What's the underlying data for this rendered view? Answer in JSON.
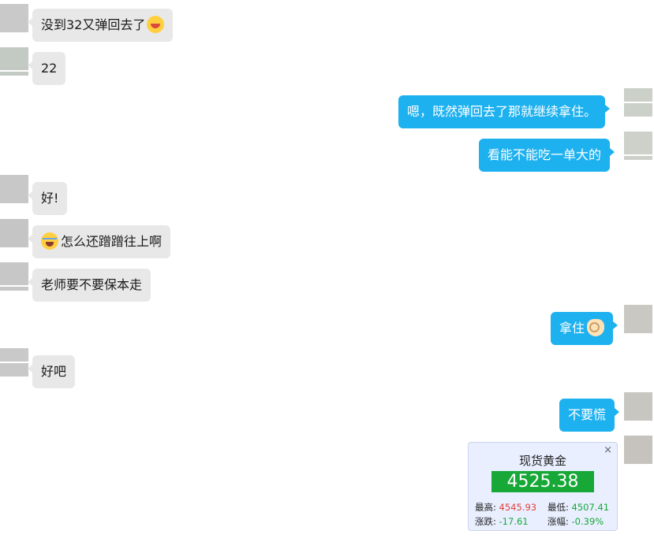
{
  "colors": {
    "incoming_bubble": "#e8e8e8",
    "outgoing_bubble": "#1eb1ef",
    "price_box": "#17a837",
    "up_red": "#e3413c",
    "down_green": "#17a837"
  },
  "messages": [
    {
      "side": "left",
      "text": "没到32又弹回去了",
      "emoji_after": "laughing-emoji"
    },
    {
      "side": "left",
      "text": "22"
    },
    {
      "side": "right",
      "text": "嗯，既然弹回去了那就继续拿住。"
    },
    {
      "side": "right",
      "text": "看能不能吃一单大的"
    },
    {
      "side": "left",
      "text": "好!"
    },
    {
      "side": "left",
      "text": "怎么还蹭蹭往上啊",
      "emoji_before": "crying-laughing-emoji"
    },
    {
      "side": "left",
      "text": "老师要不要保本走"
    },
    {
      "side": "right",
      "text": "拿住",
      "emoji_after": "ok-hand-emoji"
    },
    {
      "side": "left",
      "text": "好吧"
    },
    {
      "side": "right",
      "text": "不要慌"
    }
  ],
  "quote_widget": {
    "close_glyph": "×",
    "title": "现货黄金",
    "price": "4525.38",
    "high_label": "最高:",
    "high_value": "4545.93",
    "low_label": "最低:",
    "low_value": "4507.41",
    "change_label": "涨跌:",
    "change_value": "-17.61",
    "pct_label": "涨幅:",
    "pct_value": "-0.39%"
  }
}
